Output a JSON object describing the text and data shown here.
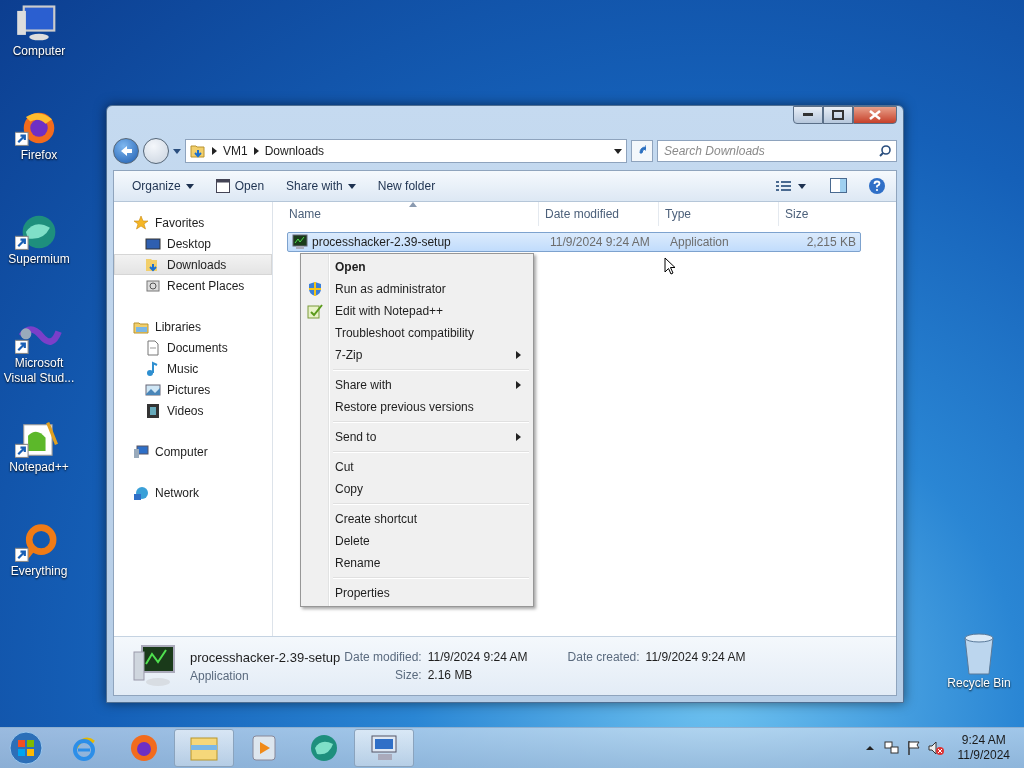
{
  "desktop_icons": [
    {
      "label": "Computer",
      "shortcut": false
    },
    {
      "label": "Firefox",
      "shortcut": true
    },
    {
      "label": "Supermium",
      "shortcut": true
    },
    {
      "label": "Microsoft Visual Stud...",
      "shortcut": true
    },
    {
      "label": "Notepad++",
      "shortcut": true
    },
    {
      "label": "Everything",
      "shortcut": true
    }
  ],
  "recycle_bin": {
    "label": "Recycle Bin"
  },
  "window": {
    "address": {
      "crumbs": [
        "VM1",
        "Downloads"
      ]
    },
    "search": {
      "placeholder": "Search Downloads"
    },
    "toolbar": [
      {
        "label": "Organize",
        "kind": "dropdown"
      },
      {
        "label": "Open",
        "kind": "icon"
      },
      {
        "label": "Share with",
        "kind": "dropdown"
      },
      {
        "label": "New folder",
        "kind": "plain"
      }
    ],
    "nav": [
      {
        "label": "Favorites",
        "children": [
          {
            "label": "Desktop",
            "selected": false
          },
          {
            "label": "Downloads",
            "selected": true
          },
          {
            "label": "Recent Places",
            "selected": false
          }
        ]
      },
      {
        "label": "Libraries",
        "children": [
          {
            "label": "Documents",
            "selected": false
          },
          {
            "label": "Music",
            "selected": false
          },
          {
            "label": "Pictures",
            "selected": false
          },
          {
            "label": "Videos",
            "selected": false
          }
        ]
      },
      {
        "label": "Computer"
      },
      {
        "label": "Network"
      }
    ],
    "columns": [
      "Name",
      "Date modified",
      "Type",
      "Size"
    ],
    "rows": [
      {
        "name": "processhacker-2.39-setup",
        "date": "11/9/2024 9:24 AM",
        "type": "Application",
        "size": "2,215 KB",
        "selected": true
      }
    ],
    "details": {
      "name": "processhacker-2.39-setup",
      "type": "Application",
      "fields": [
        {
          "label": "Date modified:",
          "value": "11/9/2024 9:24 AM"
        },
        {
          "label": "Date created:",
          "value": "11/9/2024 9:24 AM"
        },
        {
          "label": "Size:",
          "value": "2.16 MB"
        }
      ]
    }
  },
  "context_menu": {
    "items": [
      {
        "kind": "default",
        "label": "Open",
        "submenu": false
      },
      {
        "kind": "admin",
        "label": "Run as administrator",
        "submenu": false
      },
      {
        "kind": "editor",
        "label": "Edit with Notepad++",
        "submenu": false
      },
      {
        "kind": "item",
        "label": "Troubleshoot compatibility",
        "submenu": false
      },
      {
        "kind": "item",
        "label": "7-Zip",
        "submenu": true
      },
      {
        "kind": "separator"
      },
      {
        "kind": "item",
        "label": "Share with",
        "submenu": true
      },
      {
        "kind": "item",
        "label": "Restore previous versions",
        "submenu": false
      },
      {
        "kind": "separator"
      },
      {
        "kind": "item",
        "label": "Send to",
        "submenu": true
      },
      {
        "kind": "separator"
      },
      {
        "kind": "item",
        "label": "Cut",
        "submenu": false
      },
      {
        "kind": "item",
        "label": "Copy",
        "submenu": false
      },
      {
        "kind": "separator"
      },
      {
        "kind": "item",
        "label": "Create shortcut",
        "submenu": false
      },
      {
        "kind": "item",
        "label": "Delete",
        "submenu": false
      },
      {
        "kind": "item",
        "label": "Rename",
        "submenu": false
      },
      {
        "kind": "separator"
      },
      {
        "kind": "item",
        "label": "Properties",
        "submenu": false
      }
    ]
  },
  "taskbar": {
    "buttons": [
      {
        "open": false
      },
      {
        "open": false
      },
      {
        "open": true
      },
      {
        "open": false
      },
      {
        "open": false
      },
      {
        "open": true
      }
    ],
    "clock": {
      "time": "9:24 AM",
      "date": "11/9/2024"
    }
  }
}
